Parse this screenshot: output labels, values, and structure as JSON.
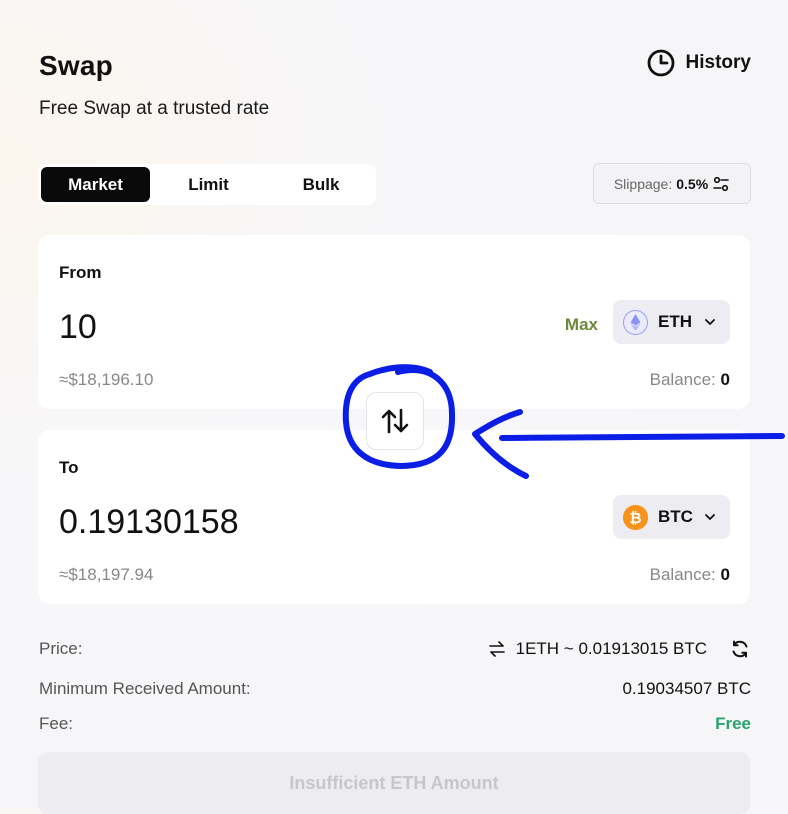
{
  "header": {
    "title": "Swap",
    "subtitle": "Free Swap at a trusted rate",
    "history_label": "History"
  },
  "tabs": [
    {
      "label": "Market",
      "active": true
    },
    {
      "label": "Limit",
      "active": false
    },
    {
      "label": "Bulk",
      "active": false
    }
  ],
  "slippage": {
    "label": "Slippage:",
    "value": "0.5%"
  },
  "from": {
    "label": "From",
    "amount": "10",
    "max_label": "Max",
    "token": "ETH",
    "usd": "≈$18,196.10",
    "balance_label": "Balance:",
    "balance_value": "0"
  },
  "to": {
    "label": "To",
    "amount": "0.19130158",
    "token": "BTC",
    "usd": "≈$18,197.94",
    "balance_label": "Balance:",
    "balance_value": "0"
  },
  "details": {
    "price_label": "Price:",
    "price_value": "1ETH ~ 0.01913015 BTC",
    "min_label": "Minimum Received Amount:",
    "min_value": "0.19034507 BTC",
    "fee_label": "Fee:",
    "fee_value": "Free"
  },
  "submit_label": "Insufficient ETH Amount",
  "colors": {
    "accent_green": "#2aa36b",
    "max_olive": "#6a8a3a",
    "eth_purple": "#8a92f2",
    "btc_orange": "#f7931a",
    "annotation_blue": "#0a1ee6"
  },
  "icons": {
    "history": "clock-icon",
    "slippage": "sliders-icon",
    "swap": "swap-arrows-icon",
    "rate": "exchange-arrows-icon",
    "refresh": "refresh-icon",
    "chevron": "chevron-down-icon"
  }
}
